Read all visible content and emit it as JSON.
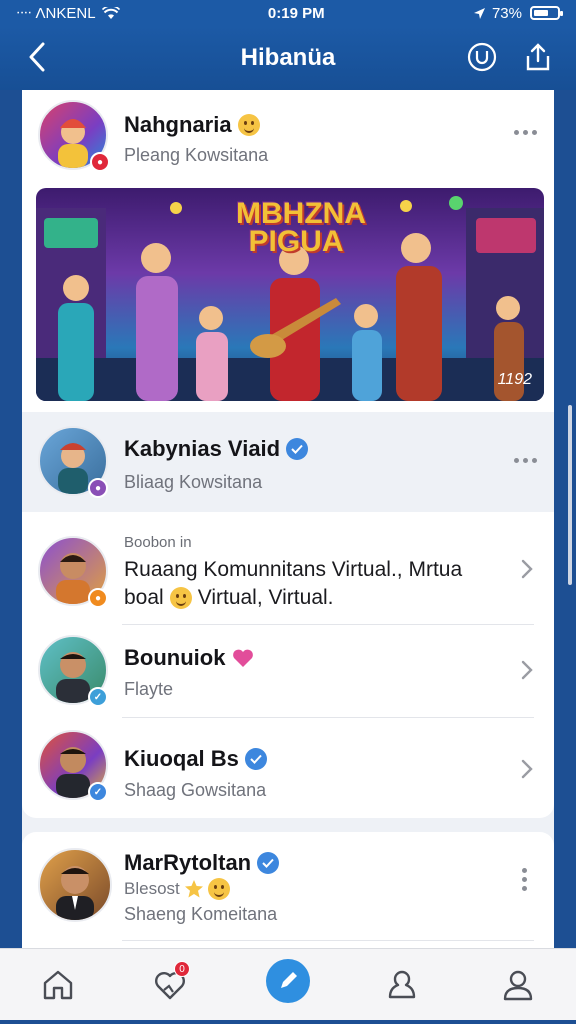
{
  "status_bar": {
    "carrier": "ᐧᐧᐧᐧ ΛNKEΝL",
    "time": "0:19 PM",
    "battery": "73%"
  },
  "nav": {
    "title": "Hibanüa",
    "back_icon": "chevron-left-icon",
    "profile_icon": "circle-u-icon",
    "share_icon": "share-icon"
  },
  "post": {
    "author": "Nahgnaria",
    "subtitle": "Pleang Kowsitana",
    "banner_title": "MBHZNA PIGUA",
    "banner_badge": "1192"
  },
  "suggested": {
    "name": "Kabynias Viaid",
    "subtitle": "Bliaag Kowsitana"
  },
  "list": [
    {
      "label_small": "Boobon in",
      "line1": "Ruaang Komunnitans Virtual., Mrtua",
      "line2": "boal",
      "line2_suffix": "Virtual, Virtual."
    },
    {
      "name": "Bounuiok",
      "subtitle": "Flayte"
    },
    {
      "name": "Kiuoqal Bs",
      "subtitle": "Shaag Gowsitana"
    }
  ],
  "bottom_card": {
    "name": "MarRytoltan",
    "line1": "Blesost",
    "subtitle": "Shaeng Komeitana"
  },
  "tab_bar": {
    "notification_count": "0"
  },
  "colors": {
    "nav_blue": "#1c5aa6",
    "verified_blue": "#3d87de",
    "badge_red": "#e0283a"
  }
}
